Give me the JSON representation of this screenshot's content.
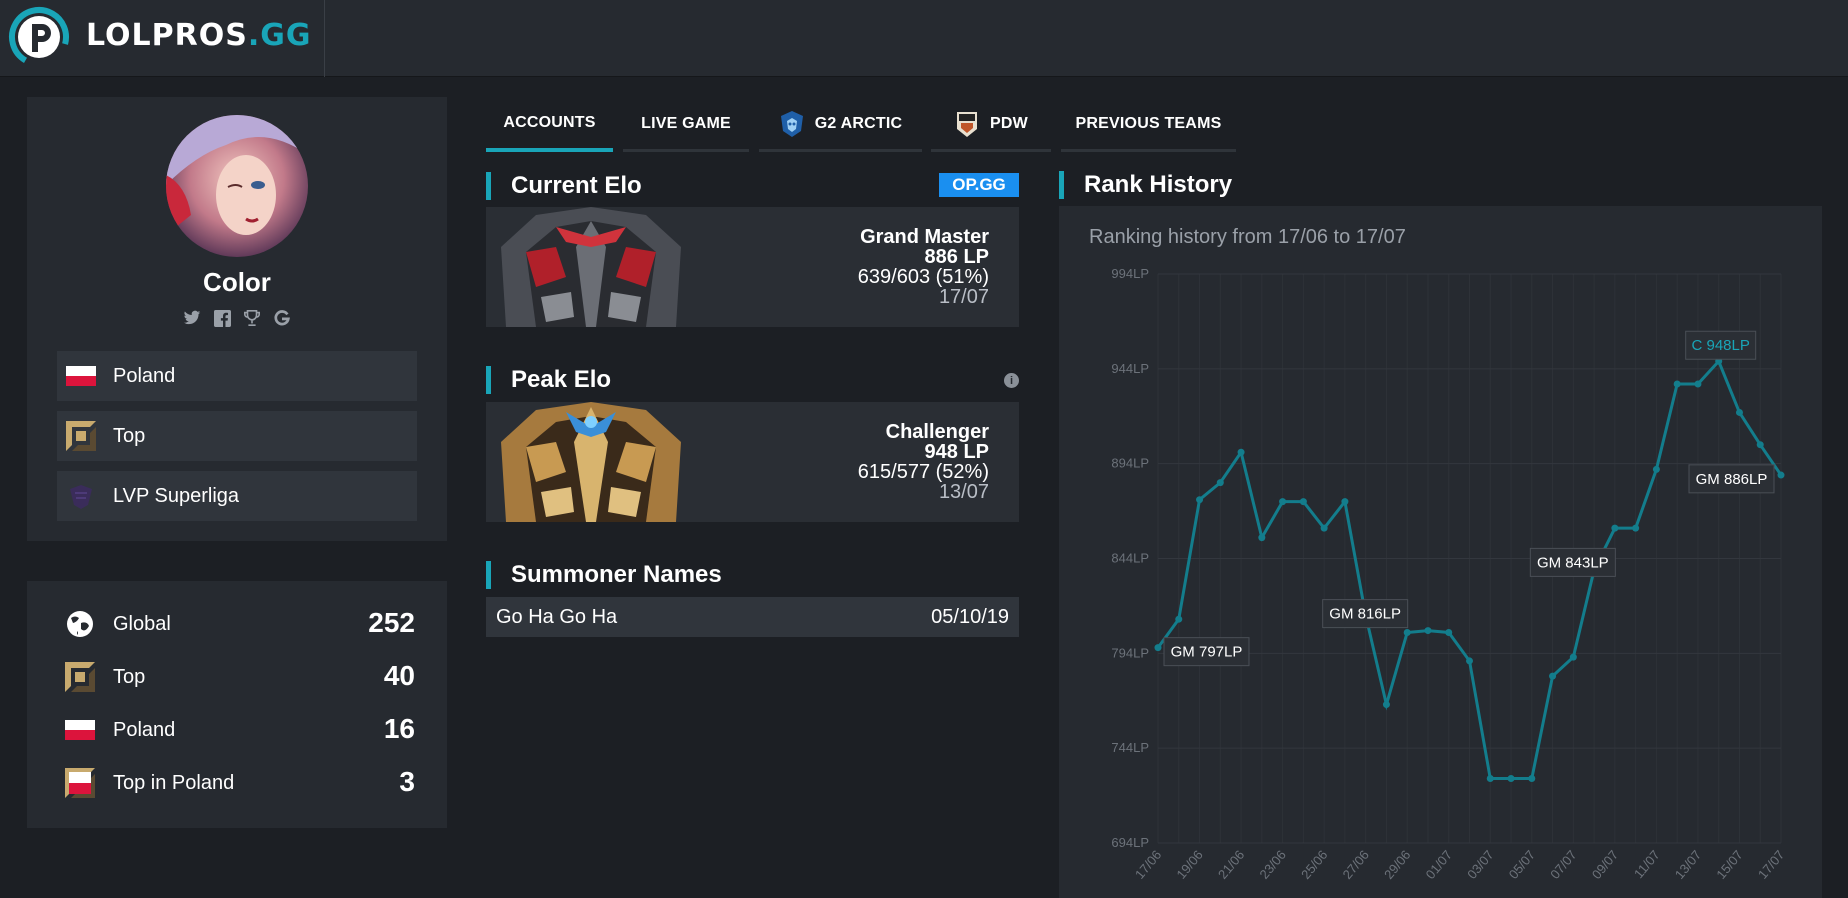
{
  "brand": {
    "name_main": "LOLPROS",
    "name_suffix": ".GG"
  },
  "profile": {
    "name": "Color",
    "socials": [
      "twitter-icon",
      "facebook-icon",
      "trophy-icon",
      "gamepedia-icon"
    ],
    "info": [
      {
        "label": "Poland",
        "icon": "poland-flag-icon"
      },
      {
        "label": "Top",
        "icon": "top-role-icon"
      },
      {
        "label": "LVP Superliga",
        "icon": "lvp-superliga-icon"
      }
    ]
  },
  "rankings": [
    {
      "label": "Global",
      "value": "252",
      "icon": "globe-icon"
    },
    {
      "label": "Top",
      "value": "40",
      "icon": "top-role-icon"
    },
    {
      "label": "Poland",
      "value": "16",
      "icon": "poland-flag-icon"
    },
    {
      "label": "Top in Poland",
      "value": "3",
      "icon": "top-poland-icon"
    }
  ],
  "tabs": [
    {
      "label": "ACCOUNTS",
      "active": true
    },
    {
      "label": "LIVE GAME",
      "active": false
    },
    {
      "label": "G2 ARCTIC",
      "active": false,
      "icon": "g2-arctic-logo-icon"
    },
    {
      "label": "PDW",
      "active": false,
      "icon": "pdw-logo-icon"
    },
    {
      "label": "PREVIOUS TEAMS",
      "active": false
    }
  ],
  "current_elo": {
    "title": "Current Elo",
    "badge": "OP.GG",
    "tier": "Grand Master",
    "lp": "886 LP",
    "winloss": "639/603 (51%)",
    "date": "17/07"
  },
  "peak_elo": {
    "title": "Peak Elo",
    "tier": "Challenger",
    "lp": "948 LP",
    "winloss": "615/577 (52%)",
    "date": "13/07"
  },
  "summoner_names": {
    "title": "Summoner Names",
    "rows": [
      {
        "name": "Go Ha Go Ha",
        "date": "05/10/19"
      }
    ]
  },
  "rank_history": {
    "title": "Rank History",
    "subtitle": "Ranking history from 17/06 to 17/07"
  },
  "colors": {
    "accent": "#19a5b8",
    "opgg": "#1a8ff0",
    "line": "#137d8c"
  },
  "chart_data": {
    "type": "line",
    "ylim": [
      694,
      994
    ],
    "yticks": [
      "994LP",
      "944LP",
      "894LP",
      "844LP",
      "794LP",
      "744LP",
      "694LP"
    ],
    "yticks_values": [
      994,
      944,
      894,
      844,
      794,
      744,
      694
    ],
    "xticks": [
      "17/06",
      "19/06",
      "21/06",
      "23/06",
      "25/06",
      "27/06",
      "29/06",
      "01/07",
      "03/07",
      "05/07",
      "07/07",
      "09/07",
      "11/07",
      "13/07",
      "15/07",
      "17/07"
    ],
    "grid": true,
    "series": [
      {
        "x": [
          0,
          1,
          2,
          3,
          4,
          5,
          6,
          7,
          8,
          9,
          10,
          11,
          12,
          13,
          14,
          15,
          16,
          17,
          18,
          19,
          20,
          21,
          22,
          23,
          24,
          25,
          26,
          27,
          28,
          29,
          30
        ],
        "values": [
          797,
          812,
          875,
          884,
          900,
          855,
          874,
          874,
          860,
          874,
          814,
          767,
          805,
          806,
          805,
          790,
          728,
          728,
          728,
          782,
          792,
          838,
          860,
          860,
          891,
          936,
          936,
          948,
          921,
          904,
          888
        ]
      }
    ],
    "annotations": [
      {
        "text": "GM 797LP",
        "x": 0,
        "y": 797
      },
      {
        "text": "GM 816LP",
        "x": 10,
        "y": 816
      },
      {
        "text": "GM 843LP",
        "x": 20,
        "y": 843
      },
      {
        "text": "C 948LP",
        "x": 27,
        "y": 948,
        "highlight": true
      },
      {
        "text": "GM 886LP",
        "x": 30,
        "y": 886
      }
    ]
  }
}
